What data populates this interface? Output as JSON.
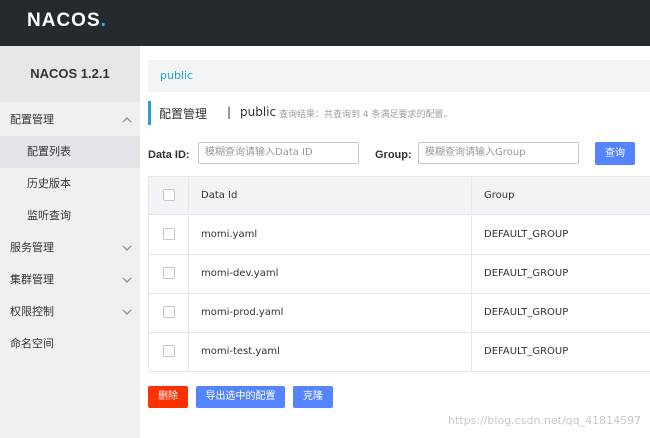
{
  "header": {
    "logo_text": "NACOS",
    "logo_dot": "."
  },
  "sidebar": {
    "version": "NACOS 1.2.1",
    "items": [
      {
        "label": "配置管理",
        "chevron": "up"
      },
      {
        "label": "配置列表"
      },
      {
        "label": "历史版本"
      },
      {
        "label": "监听查询"
      },
      {
        "label": "服务管理",
        "chevron": "down"
      },
      {
        "label": "集群管理",
        "chevron": "down"
      },
      {
        "label": "权限控制",
        "chevron": "down"
      },
      {
        "label": "命名空间"
      }
    ]
  },
  "main": {
    "namespace_tab": "public",
    "title": "配置管理",
    "title_sep": "|",
    "title_namespace": "public",
    "result_text": "查询结果：共查询到 4 条满足要求的配置。",
    "search": {
      "data_id_label": "Data ID:",
      "data_id_placeholder": "模糊查询请输入Data ID",
      "group_label": "Group:",
      "group_placeholder": "模糊查询请输入Group",
      "query_button": "查询"
    },
    "table": {
      "headers": {
        "data_id": "Data Id",
        "group": "Group"
      },
      "rows": [
        {
          "data_id": "momi.yaml",
          "group": "DEFAULT_GROUP"
        },
        {
          "data_id": "momi-dev.yaml",
          "group": "DEFAULT_GROUP"
        },
        {
          "data_id": "momi-prod.yaml",
          "group": "DEFAULT_GROUP"
        },
        {
          "data_id": "momi-test.yaml",
          "group": "DEFAULT_GROUP"
        }
      ]
    },
    "actions": {
      "delete": "删除",
      "export": "导出选中的配置",
      "clone": "克隆"
    }
  },
  "watermark": "https://blog.csdn.net/qq_41814597",
  "colors": {
    "topbar": "#252a2f",
    "accent": "#1ec0d6",
    "primary_button": "#5584ff",
    "danger_button": "#ff3000"
  }
}
